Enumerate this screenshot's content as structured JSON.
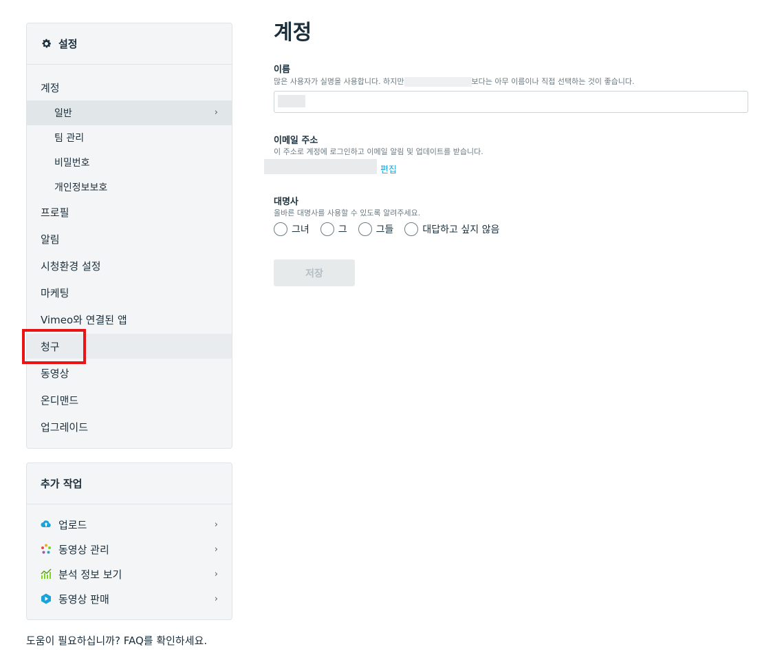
{
  "sidebar": {
    "header": "설정",
    "account_section": "계정",
    "sub_items": [
      {
        "label": "일반",
        "active": true
      },
      {
        "label": "팀 관리"
      },
      {
        "label": "비밀번호"
      },
      {
        "label": "개인정보보호"
      }
    ],
    "items": [
      {
        "label": "프로필"
      },
      {
        "label": "알림"
      },
      {
        "label": "시청환경 설정"
      },
      {
        "label": "마케팅"
      },
      {
        "label": "Vimeo와 연결된 앱"
      },
      {
        "label": "청구",
        "highlighted": true
      },
      {
        "label": "동영상"
      },
      {
        "label": "온디맨드"
      },
      {
        "label": "업그레이드"
      }
    ]
  },
  "extra": {
    "header": "추가 작업",
    "items": [
      {
        "label": "업로드",
        "icon": "cloud-upload-icon"
      },
      {
        "label": "동영상 관리",
        "icon": "manage-videos-icon"
      },
      {
        "label": "분석 정보 보기",
        "icon": "analytics-icon"
      },
      {
        "label": "동영상 판매",
        "icon": "sell-video-icon"
      }
    ]
  },
  "help": "도움이 필요하십니까? FAQ를 확인하세요.",
  "main": {
    "title": "계정",
    "name": {
      "label": "이름",
      "help_a": "많은 사용자가 실명을 사용합니다. 하지만",
      "help_b": "보다는 아무 이름이나 직접 선택하는 것이 좋습니다."
    },
    "email": {
      "label": "이메일 주소",
      "help": "이 주소로 계정에 로그인하고 이메일 알림 및 업데이트를 받습니다.",
      "edit": "편집"
    },
    "pronoun": {
      "label": "대명사",
      "help": "올바른 대명사를 사용할 수 있도록 알려주세요.",
      "options": [
        "그녀",
        "그",
        "그들",
        "대답하고 싶지 않음"
      ]
    },
    "save": "저장"
  },
  "colors": {
    "accent": "#1aa3d9",
    "highlight": "#ea1414"
  }
}
